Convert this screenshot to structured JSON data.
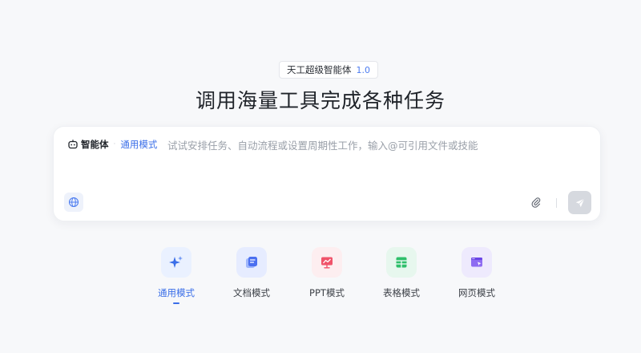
{
  "badge": {
    "name": "天工超级智能体",
    "version": "1.0"
  },
  "headline": "调用海量工具完成各种任务",
  "composer": {
    "agent_label": "智能体",
    "separator": "·",
    "mode_label": "通用模式",
    "placeholder": "试试安排任务、自动流程或设置周期性工作，输入@可引用文件或技能"
  },
  "modes": [
    {
      "label": "通用模式",
      "icon": "sparkle-icon",
      "active": true
    },
    {
      "label": "文档模式",
      "icon": "document-icon",
      "active": false
    },
    {
      "label": "PPT模式",
      "icon": "presentation-icon",
      "active": false
    },
    {
      "label": "表格模式",
      "icon": "spreadsheet-icon",
      "active": false
    },
    {
      "label": "网页模式",
      "icon": "webpage-icon",
      "active": false
    }
  ],
  "colors": {
    "accent": "#3a6ee8",
    "general_tile": "#eaf1ff",
    "doc_tile": "#e6ecff",
    "ppt_tile": "#fdeef0",
    "sheet_tile": "#e7f7ee",
    "web_tile": "#eeeafd"
  }
}
